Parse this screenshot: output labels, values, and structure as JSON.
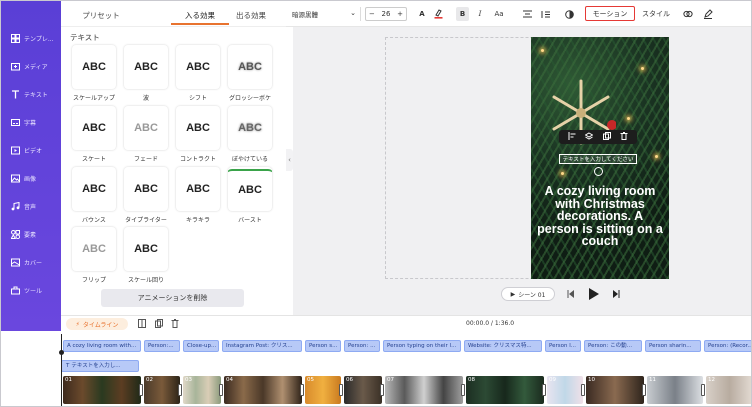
{
  "nav": {
    "items": [
      {
        "label": "テンプレ..."
      },
      {
        "label": "メディア"
      },
      {
        "label": "テキスト"
      },
      {
        "label": "字幕"
      },
      {
        "label": "ビデオ"
      },
      {
        "label": "画像"
      },
      {
        "label": "音声"
      },
      {
        "label": "要素"
      },
      {
        "label": "カバー"
      },
      {
        "label": "ツール"
      }
    ]
  },
  "tabs": {
    "preset": "プリセット",
    "in": "入る効果",
    "out": "出る効果",
    "active": "入る効果"
  },
  "toolbar": {
    "font": "暗源黒體",
    "font_size": "26",
    "text_color_label": "A",
    "bold": "B",
    "italic": "I",
    "case": "Aa",
    "motion": "モーション",
    "style": "スタイル"
  },
  "panel": {
    "title": "テキスト",
    "effects": [
      {
        "label": "スケールアップ",
        "sample": "ABC"
      },
      {
        "label": "波",
        "sample": "ABC"
      },
      {
        "label": "シフト",
        "sample": "ABC"
      },
      {
        "label": "グロッシーボケ",
        "sample": "ABC"
      },
      {
        "label": "スケート",
        "sample": "ABC"
      },
      {
        "label": "フェード",
        "sample": "ABC"
      },
      {
        "label": "コントラクト",
        "sample": "ABC"
      },
      {
        "label": "ぼやけている",
        "sample": "ABC"
      },
      {
        "label": "バウンス",
        "sample": "ABC"
      },
      {
        "label": "タイプライター",
        "sample": "ABC"
      },
      {
        "label": "キラキラ",
        "sample": "ABC"
      },
      {
        "label": "バースト",
        "sample": "ABC"
      },
      {
        "label": "フリップ",
        "sample": "ABC"
      },
      {
        "label": "スケール回り",
        "sample": "ABC"
      }
    ],
    "remove_button": "アニメーションを削除"
  },
  "canvas": {
    "text_hint": "テキストを入力してください",
    "caption": "A cozy living room with Christmas decorations. A person is sitting on a couch"
  },
  "playbar": {
    "scene_label": "シーン 01"
  },
  "timeline": {
    "label": "タイムライン",
    "time": "00:00.0 / 1:36.0",
    "clips": [
      "A cozy living room with...",
      "Person:...",
      "Close-up...",
      "Instagram Post: クリス...",
      "Person s...",
      "Person: ...",
      "Person typing on their l...",
      "Website: クリスマス特...",
      "Person l...",
      "Person: この動…",
      "Person sharin...",
      "Person: (Recor..."
    ],
    "text_track": "テキストを入力し...",
    "frame_numbers": [
      "01",
      "02",
      "03",
      "04",
      "05",
      "06",
      "07",
      "08",
      "09",
      "10",
      "11",
      "12"
    ]
  },
  "colors": {
    "nav_bg": "#5a3fd6",
    "accent": "#e8732f",
    "motion_border": "#e53935",
    "clip": "#b7c9f7"
  }
}
